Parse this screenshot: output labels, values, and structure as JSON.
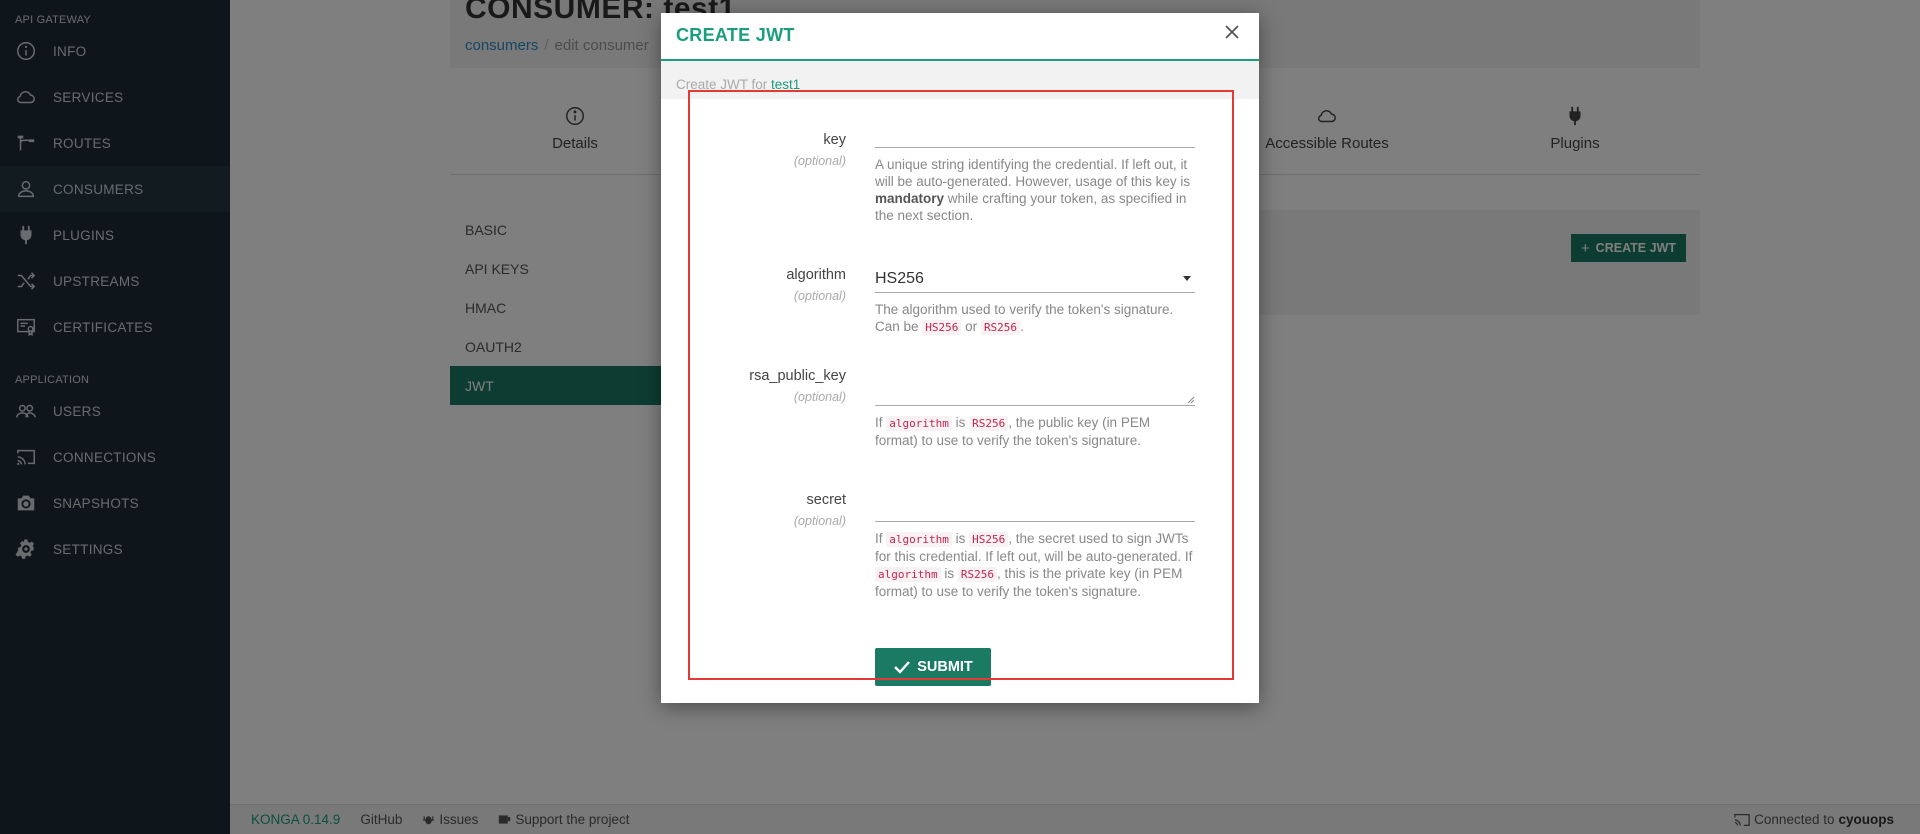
{
  "sidebar": {
    "section_gateway": "API GATEWAY",
    "section_application": "APPLICATION",
    "gateway_items": [
      {
        "label": "INFO",
        "icon": "info-icon"
      },
      {
        "label": "SERVICES",
        "icon": "cloud-icon"
      },
      {
        "label": "ROUTES",
        "icon": "routes-icon"
      },
      {
        "label": "CONSUMERS",
        "icon": "user-icon"
      },
      {
        "label": "PLUGINS",
        "icon": "plug-icon"
      },
      {
        "label": "UPSTREAMS",
        "icon": "shuffle-icon"
      },
      {
        "label": "CERTIFICATES",
        "icon": "certificate-icon"
      }
    ],
    "app_items": [
      {
        "label": "USERS",
        "icon": "users-icon"
      },
      {
        "label": "CONNECTIONS",
        "icon": "cast-icon"
      },
      {
        "label": "SNAPSHOTS",
        "icon": "camera-icon"
      },
      {
        "label": "SETTINGS",
        "icon": "gear-icon"
      }
    ]
  },
  "page": {
    "title": "CONSUMER: test1",
    "breadcrumb": {
      "link": "consumers",
      "separator": "/",
      "current": "edit consumer"
    }
  },
  "tabs": [
    {
      "label": "Details",
      "icon": "info-icon"
    },
    {
      "label": "Accessible Routes",
      "icon": "cloud-icon"
    },
    {
      "label": "Plugins",
      "icon": "plug-icon"
    }
  ],
  "credential_menu": [
    "BASIC",
    "API KEYS",
    "HMAC",
    "OAUTH2",
    "JWT"
  ],
  "create_jwt_button": "CREATE JWT",
  "footer": {
    "brand": "KONGA 0.14.9",
    "github": "GitHub",
    "issues": "Issues",
    "support": "Support the project",
    "connected_prefix": "Connected to",
    "connected_name": "cyouops"
  },
  "modal": {
    "title": "CREATE JWT",
    "subtitle_prefix": "Create JWT for",
    "subtitle_name": "test1",
    "optional_label": "(optional)",
    "fields": {
      "key": {
        "label": "key",
        "help_1": "A unique string identifying the credential. If left out, it will be auto-generated. However, usage of this key is ",
        "help_bold": "mandatory",
        "help_2": " while crafting your token, as specified in the next section."
      },
      "algorithm": {
        "label": "algorithm",
        "value": "HS256",
        "help_1": "The algorithm used to verify the token's signature. Can be ",
        "code_1": "HS256",
        "help_2": " or ",
        "code_2": "RS256",
        "help_3": "."
      },
      "rsa_public_key": {
        "label": "rsa_public_key",
        "help_1": "If ",
        "code_1": "algorithm",
        "help_2": " is ",
        "code_2": "RS256",
        "help_3": ", the public key (in PEM format) to use to verify the token's signature."
      },
      "secret": {
        "label": "secret",
        "help_1": "If ",
        "code_1": "algorithm",
        "help_2": " is ",
        "code_2": "HS256",
        "help_3": ", the secret used to sign JWTs for this credential. If left out, will be auto-generated. If ",
        "code_3": "algorithm",
        "help_4": " is ",
        "code_4": "RS256",
        "help_5": ", this is the private key (in PEM format) to use to verify the token's signature."
      }
    },
    "submit_label": "SUBMIT"
  },
  "colors": {
    "accent": "#1b9e7e",
    "button": "#1b7a64",
    "sidebar_bg": "#1f2d37",
    "highlight": "#e53935"
  }
}
